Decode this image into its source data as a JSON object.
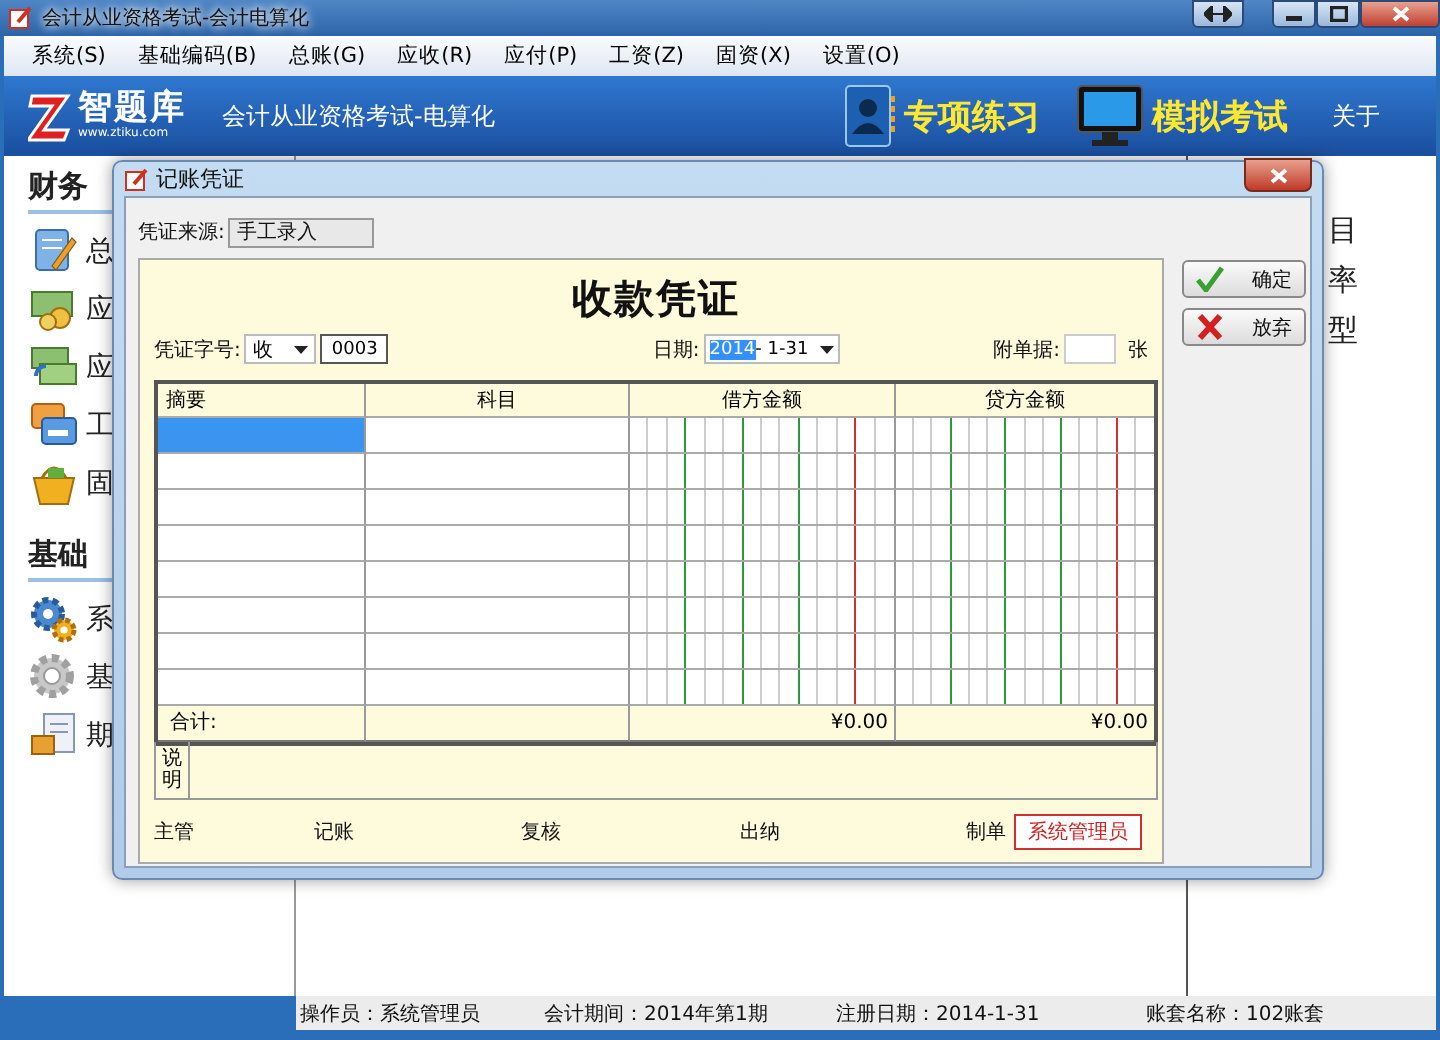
{
  "window": {
    "title": "会计从业资格考试-会计电算化"
  },
  "menu": [
    "系统(S)",
    "基础编码(B)",
    "总账(G)",
    "应收(R)",
    "应付(P)",
    "工资(Z)",
    "固资(X)",
    "设置(O)"
  ],
  "banner": {
    "logo": "智题库",
    "logo_url": "www.ztiku.com",
    "subtitle": "会计从业资格考试-电算化",
    "buttons": [
      {
        "label": "专项练习",
        "kind": "contacts"
      },
      {
        "label": "模拟考试",
        "kind": "monitor"
      }
    ],
    "about": "关于"
  },
  "sidebar": [
    {
      "title": "财务",
      "items": [
        {
          "label": "总"
        },
        {
          "label": "应"
        },
        {
          "label": "应"
        },
        {
          "label": "工"
        },
        {
          "label": "固"
        }
      ]
    },
    {
      "title": "基础",
      "items": [
        {
          "label": "系"
        },
        {
          "label": "基"
        },
        {
          "label": "期"
        }
      ]
    }
  ],
  "right_panel": {
    "labels": [
      "目",
      "率",
      "型"
    ]
  },
  "dialog": {
    "title": "记账凭证",
    "source_label": "凭证来源:",
    "source_value": "手工录入",
    "voucher": {
      "title": "收款凭证",
      "number_label": "凭证字号:",
      "type_value": "收",
      "number": "0003",
      "date_label": "日期:",
      "date_parts": [
        {
          "text": "2014",
          "selected": true
        },
        {
          "text": "- 1-31",
          "selected": false
        }
      ],
      "attachments_label": "附单据:",
      "attachments_unit": "张",
      "columns": [
        "摘要",
        "科目",
        "借方金额",
        "贷方金额"
      ],
      "rows": [
        {
          "selected": true
        },
        {
          "selected": false
        },
        {
          "selected": false
        },
        {
          "selected": false
        },
        {
          "selected": false
        },
        {
          "selected": false
        },
        {
          "selected": false
        },
        {
          "selected": false
        }
      ],
      "totals": {
        "label": "合计:",
        "debit": "¥0.00",
        "credit": "¥0.00"
      },
      "note_label": "说明",
      "signatures": [
        {
          "label": "主管"
        },
        {
          "label": "记账"
        },
        {
          "label": "复核"
        },
        {
          "label": "出纳"
        },
        {
          "label": "制单",
          "value": "系统管理员"
        }
      ]
    },
    "buttons": [
      {
        "label": "确定",
        "kind": "confirm"
      },
      {
        "label": "放弃",
        "kind": "cancel"
      }
    ]
  },
  "status_bar": [
    {
      "label": "操作员：",
      "value": "系统管理员"
    },
    {
      "label": "会计期间：2014年第1期"
    },
    {
      "label": "注册日期：2014-1-31"
    },
    {
      "label": "账套名称：102账套"
    }
  ]
}
